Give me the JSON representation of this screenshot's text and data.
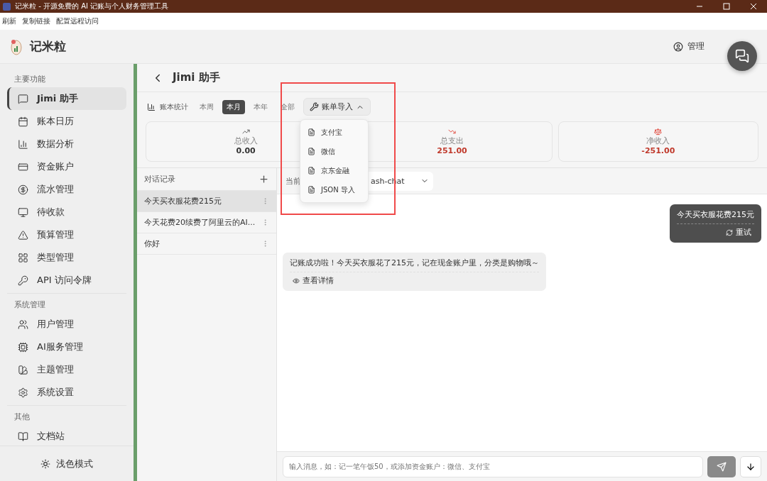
{
  "window": {
    "title": "记米粒 - 开源免费的 AI 记账与个人财务管理工具"
  },
  "menu": [
    "刷新",
    "复制链接",
    "配置远程访问"
  ],
  "app": {
    "name": "记米粒",
    "user": "管理"
  },
  "sidebar": {
    "sections": [
      {
        "title": "主要功能",
        "items": [
          {
            "label": "Jimi 助手",
            "selected": true
          },
          {
            "label": "账本日历",
            "selected": false
          },
          {
            "label": "数据分析",
            "selected": false
          },
          {
            "label": "资金账户",
            "selected": false
          },
          {
            "label": "流水管理",
            "selected": false
          },
          {
            "label": "待收款",
            "selected": false
          },
          {
            "label": "预算管理",
            "selected": false
          },
          {
            "label": "类型管理",
            "selected": false
          },
          {
            "label": "API 访问令牌",
            "selected": false
          }
        ]
      },
      {
        "title": "系统管理",
        "items": [
          {
            "label": "用户管理",
            "selected": false
          },
          {
            "label": "AI服务管理",
            "selected": false
          },
          {
            "label": "主题管理",
            "selected": false
          },
          {
            "label": "系统设置",
            "selected": false
          }
        ]
      },
      {
        "title": "其他",
        "items": [
          {
            "label": "文档站",
            "selected": false
          }
        ]
      }
    ],
    "theme_button": "浅色模式"
  },
  "page": {
    "title": "Jimi 助手"
  },
  "stats_bar": {
    "label": "账本统计",
    "periods": [
      {
        "label": "本周",
        "selected": false
      },
      {
        "label": "本月",
        "selected": true
      },
      {
        "label": "本年",
        "selected": false
      },
      {
        "label": "全部",
        "selected": false
      }
    ],
    "import_button": {
      "label": "账单导入",
      "expanded": true,
      "options": [
        "支付宝",
        "微信",
        "京东金融",
        "JSON 导入"
      ]
    }
  },
  "stats": [
    {
      "kind": "income",
      "label": "总收入",
      "value": "0.00",
      "color": "#333333"
    },
    {
      "kind": "expense",
      "label": "总支出",
      "value": "251.00",
      "color": "#c0392b"
    },
    {
      "kind": "net",
      "label": "净收入",
      "value": "-251.00",
      "color": "#c0392b"
    }
  ],
  "conversations": {
    "title": "对话记录",
    "items": [
      {
        "title": "今天买衣服花费215元",
        "selected": true
      },
      {
        "title": "今天花费20续费了阿里云的AI...",
        "selected": false
      },
      {
        "title": "你好",
        "selected": false
      }
    ]
  },
  "model_row": {
    "label": "当前",
    "value": "ash-chat"
  },
  "messages": [
    {
      "kind": "user",
      "text": "今天买衣服花费215元",
      "action": "重试"
    },
    {
      "kind": "assistant",
      "text": "记账成功啦！今天买衣服花了215元，记在现金账户里，分类是购物哦～",
      "action": "查看详情"
    }
  ],
  "composer": {
    "placeholder": "输入消息，如：记一笔午饭50，或添加资金账户：微信、支付宝"
  },
  "annotation": {
    "kind": "frame",
    "color": "#f04a4a"
  }
}
